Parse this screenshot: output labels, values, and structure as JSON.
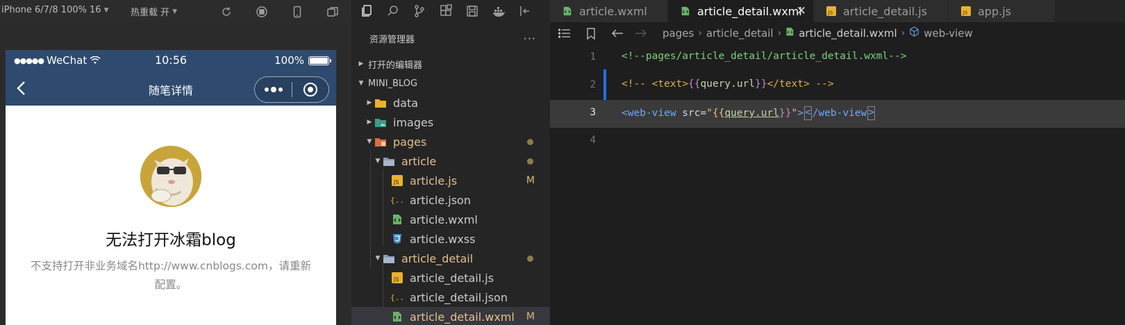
{
  "simulator": {
    "device_label": "iPhone 6/7/8 100% 16",
    "hot_reload_label": "热重载 开",
    "statusbar": {
      "carrier": "WeChat",
      "time": "10:56",
      "battery_label": "100%",
      "battery_level": 1.0
    },
    "navbar": {
      "title": "随笔详情"
    },
    "error": {
      "title": "无法打开冰霜blog",
      "description": "不支持打开非业务域名http://www.cnblogs.com，请重新配置。"
    }
  },
  "explorer": {
    "header": "资源管理器",
    "more_label": "···",
    "open_editors_label": "打开的编辑器",
    "project_label": "MINI_BLOG",
    "items": [
      {
        "label": "data",
        "type": "folder",
        "icon": "folder-data-icon"
      },
      {
        "label": "images",
        "type": "folder",
        "icon": "folder-images-icon"
      },
      {
        "label": "pages",
        "type": "folder",
        "icon": "folder-pages-icon",
        "modified": true
      },
      {
        "label": "article",
        "type": "folder",
        "icon": "folder-icon",
        "modified": true
      },
      {
        "label": "article.js",
        "type": "file",
        "icon": "js-file-icon",
        "status": "M"
      },
      {
        "label": "article.json",
        "type": "file",
        "icon": "json-file-icon"
      },
      {
        "label": "article.wxml",
        "type": "file",
        "icon": "wxml-file-icon"
      },
      {
        "label": "article.wxss",
        "type": "file",
        "icon": "css-file-icon"
      },
      {
        "label": "article_detail",
        "type": "folder",
        "icon": "folder-icon",
        "modified": true
      },
      {
        "label": "article_detail.js",
        "type": "file",
        "icon": "js-file-icon"
      },
      {
        "label": "article_detail.json",
        "type": "file",
        "icon": "json-file-icon"
      },
      {
        "label": "article_detail.wxml",
        "type": "file",
        "icon": "wxml-file-icon",
        "status": "M"
      }
    ]
  },
  "editor": {
    "tabs": [
      {
        "label": "article.wxml",
        "icon": "wxml-file-icon"
      },
      {
        "label": "article_detail.wxml",
        "icon": "wxml-file-icon",
        "active": true
      },
      {
        "label": "article_detail.js",
        "icon": "js-file-icon"
      },
      {
        "label": "app.js",
        "icon": "js-file-icon"
      }
    ],
    "breadcrumb": {
      "segment1": "pages",
      "segment2": "article_detail",
      "segment3": "article_detail.wxml",
      "segment4": "web-view"
    },
    "lines": {
      "n1": "1",
      "n2": "2",
      "n3": "3",
      "n4": "4",
      "l1": "<!--pages/article_detail/article_detail.wxml-->",
      "l2_open": "<!-- ",
      "l2_tag_open": "<text>",
      "l2_brace_open": "{{",
      "l2_var": "query.url",
      "l2_brace_close": "}}",
      "l2_tag_close": "</text>",
      "l2_close": " -->",
      "l3_tag": "<web-view",
      "l3_attr": " src=",
      "l3_quote_open": "\"",
      "l3_brace_open": "{{",
      "l3_var": "query.url",
      "l3_brace_close": "}}",
      "l3_quote_close": "\"",
      "l3_gt": ">",
      "l3_close_lt": "<",
      "l3_close": "/web-view",
      "l3_close_gt": ">"
    }
  },
  "colors": {
    "navbar": "#2e4a6e",
    "editor_bg": "#1e1e1e",
    "explorer_bg": "#252526",
    "accent": "#1f6feb"
  }
}
